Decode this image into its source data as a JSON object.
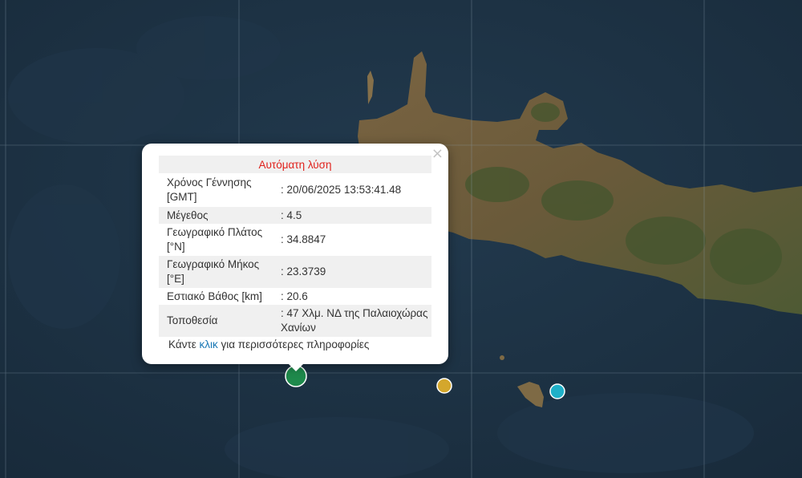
{
  "popup": {
    "close": "×",
    "header": "Αυτόματη λύση",
    "rows": [
      {
        "label": "Χρόνος Γέννησης [GMT]",
        "value": ": 20/06/2025 13:53:41.48"
      },
      {
        "label": "Μέγεθος",
        "value": ": 4.5"
      },
      {
        "label": "Γεωγραφικό Πλάτος [°N]",
        "value": ": 34.8847"
      },
      {
        "label": "Γεωγραφικό Μήκος [°E]",
        "value": ": 23.3739"
      },
      {
        "label": "Εστιακό Βάθος [km]",
        "value": ": 20.6"
      },
      {
        "label": "Τοποθεσία",
        "value": ": 47 Χλμ. ΝΔ της Παλαιοχώρας Χανίων"
      }
    ],
    "more_prefix": "Κάντε ",
    "more_link": "κλικ",
    "more_suffix": " για περισσότερες πληροφορίες"
  },
  "markers": [
    {
      "name": "selected-quake",
      "color": "#1f8a4c"
    },
    {
      "name": "quake-2",
      "color": "#d4a72c"
    },
    {
      "name": "quake-3",
      "color": "#1fb0c8"
    }
  ],
  "colors": {
    "sea": "#1e3446",
    "land": "#6b5a3a",
    "vegetation": "#3e5a2e"
  }
}
